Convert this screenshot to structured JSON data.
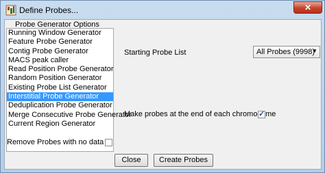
{
  "window": {
    "title": "Define Probes...",
    "close_glyph": "✕"
  },
  "left_panel": {
    "title": "Probe Generator Options",
    "items": [
      {
        "label": "Running Window Generator",
        "selected": false
      },
      {
        "label": "Feature Probe Generator",
        "selected": false
      },
      {
        "label": "Contig Probe Generator",
        "selected": false
      },
      {
        "label": "MACS peak caller",
        "selected": false
      },
      {
        "label": "Read Position Probe Generator",
        "selected": false
      },
      {
        "label": "Random Position Generator",
        "selected": false
      },
      {
        "label": "Existing Probe List Generator",
        "selected": false
      },
      {
        "label": "Interstitial Probe Generator",
        "selected": true
      },
      {
        "label": "Deduplication Probe Generator",
        "selected": false
      },
      {
        "label": "Merge Consecutive Probe Generator",
        "selected": false
      },
      {
        "label": "Current Region Generator",
        "selected": false
      }
    ],
    "remove_no_data_label": "Remove Probes with no data",
    "remove_no_data_checked": false
  },
  "options": {
    "starting_probe_list_label": "Starting Probe List",
    "starting_probe_list_value": "All Probes (9998)",
    "ends_label": "Make probes at the end of each chromosome",
    "ends_checked": true
  },
  "buttons": {
    "close": "Close",
    "create": "Create Probes"
  },
  "colors": {
    "selection": "#3399ff",
    "close_button": "#c7432b"
  }
}
